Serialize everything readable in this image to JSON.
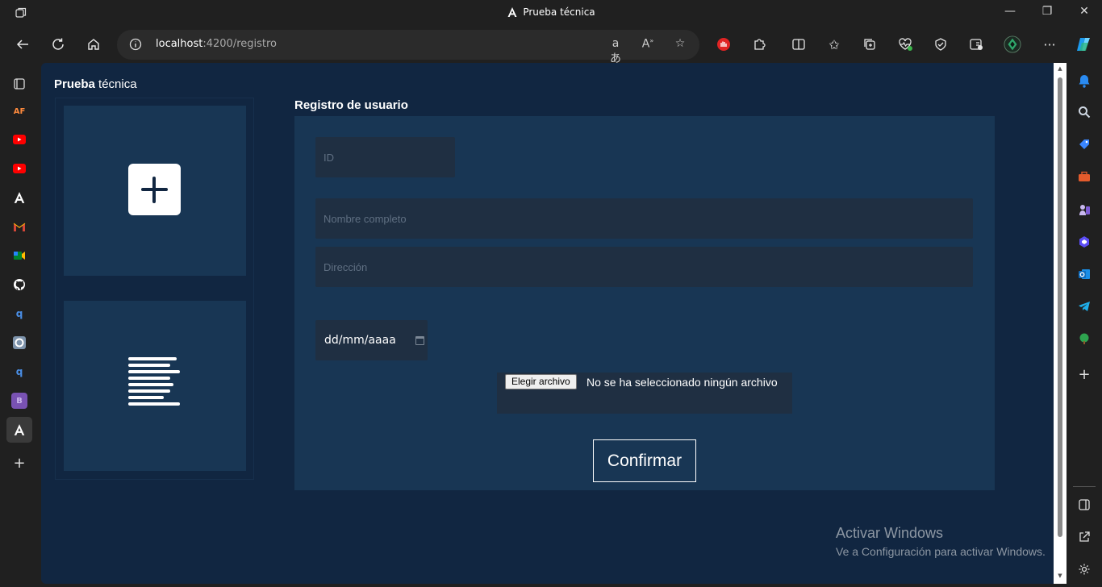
{
  "window": {
    "title": "Prueba técnica",
    "controls": [
      "minimize",
      "restore",
      "close"
    ]
  },
  "toolbar": {
    "url_host": "localhost",
    "url_rest": ":4200/registro",
    "icons": [
      "back-icon",
      "refresh-icon",
      "home-icon",
      "info-icon",
      "read-aloud-icon",
      "text-size-icon",
      "favorite-star-icon",
      "stop-sign-extension-icon",
      "extensions-icon",
      "split-screen-icon",
      "favorites-icon",
      "collections-icon",
      "performance-icon",
      "browser-essentials-icon",
      "drop-icon",
      "profile-avatar-icon",
      "more-icon",
      "copilot-icon"
    ]
  },
  "vertical_tabs": [
    {
      "name": "tab-actions-icon",
      "text": ""
    },
    {
      "name": "tab-af",
      "text": "AF",
      "color": "#d04a2a"
    },
    {
      "name": "tab-youtube-1",
      "text": "▶",
      "color": "#ff0000"
    },
    {
      "name": "tab-youtube-2",
      "text": "▶",
      "color": "#ff0000"
    },
    {
      "name": "tab-angular-1",
      "text": "A",
      "color": "#ffffff"
    },
    {
      "name": "tab-gmail",
      "text": "M",
      "color": "#d44638"
    },
    {
      "name": "tab-meet",
      "text": "■",
      "color": "#00832d"
    },
    {
      "name": "tab-github",
      "text": "●",
      "color": "#ffffff"
    },
    {
      "name": "tab-search-1",
      "text": "q",
      "color": "#4a8fe7"
    },
    {
      "name": "tab-circle-app",
      "text": "◎",
      "color": "#9fb3c8"
    },
    {
      "name": "tab-search-2",
      "text": "q",
      "color": "#4a8fe7"
    },
    {
      "name": "tab-bootstrap",
      "text": "B",
      "color": "#7952b3"
    },
    {
      "name": "tab-angular-active",
      "text": "A",
      "color": "#ffffff"
    },
    {
      "name": "new-tab-button",
      "text": "+",
      "color": "#dddddd"
    }
  ],
  "right_sidebar": [
    "bell-icon",
    "search-icon",
    "shopping-tag-icon",
    "tools-icon",
    "games-icon",
    "copilot-sidebar-icon",
    "outlook-icon",
    "telegram-icon",
    "tree-icon",
    "add-icon",
    "sidebar-toggle-icon",
    "external-icon",
    "settings-icon"
  ],
  "page": {
    "brand_bold": "Prueba",
    "brand_rest": " técnica",
    "cards": [
      {
        "name": "add-card",
        "icon": "plus-icon"
      },
      {
        "name": "list-card",
        "icon": "list-icon"
      }
    ],
    "form": {
      "title": "Registro de usuario",
      "id_placeholder": "ID",
      "name_placeholder": "Nombre completo",
      "address_placeholder": "Dirección",
      "date_value": "dd/mm/aaaa",
      "file_button": "Elegir archivo",
      "file_status": "No se ha seleccionado ningún archivo",
      "confirm_label": "Confirmar"
    }
  },
  "watermark": {
    "line1": "Activar Windows",
    "line2": "Ve a Configuración para activar Windows."
  },
  "colors": {
    "page_bg": "#112641",
    "panel_bg": "#183654",
    "field_bg": "#1f2f42",
    "browser_chrome": "#202020"
  }
}
